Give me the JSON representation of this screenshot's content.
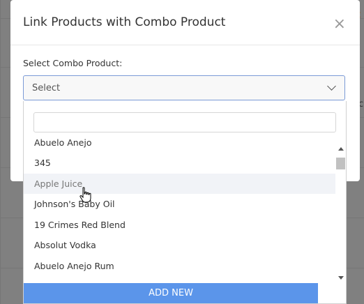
{
  "background": {
    "right_text": "t",
    "right_text2": "c"
  },
  "modal": {
    "title": "Link Products with Combo Product",
    "close_label": "×",
    "field_label": "Select Combo Product:",
    "select_value": "Select",
    "search_value": "",
    "options": [
      {
        "label": "Abuelo Anejo"
      },
      {
        "label": "345"
      },
      {
        "label": "Apple Juice"
      },
      {
        "label": "Johnson's Baby Oil"
      },
      {
        "label": "19 Crimes Red Blend"
      },
      {
        "label": "Absolut Vodka"
      },
      {
        "label": "Abuelo Anejo Rum"
      }
    ],
    "hovered_index": 2,
    "add_new_label": "ADD NEW"
  },
  "icons": {
    "close": "close-icon",
    "chevron": "chevron-down-icon",
    "cursor": "hand-pointer-icon"
  },
  "colors": {
    "accent": "#5b95ea",
    "select_border": "#7a9ad6",
    "overlay": "#808080"
  }
}
